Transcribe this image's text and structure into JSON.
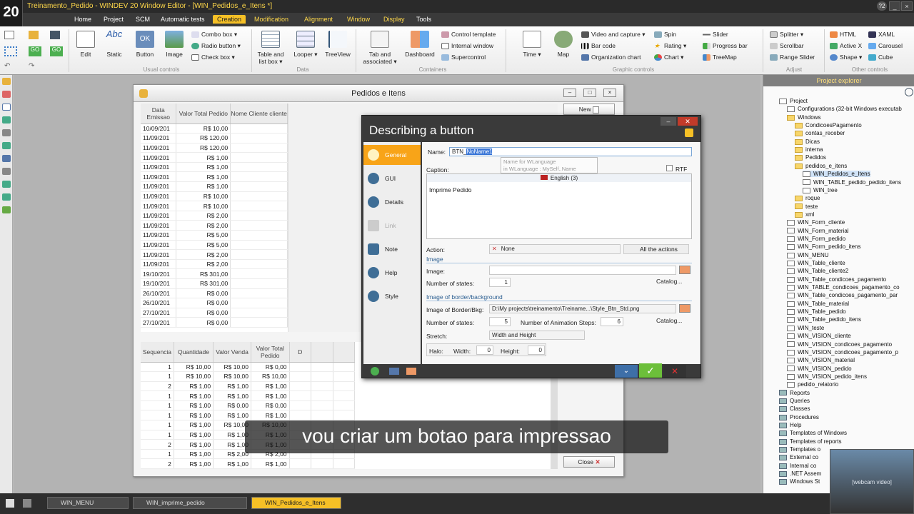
{
  "app": {
    "logo": "20",
    "title": "Treinamento_Pedido - WINDEV 20  Window Editor - [WIN_Pedidos_e_Itens *]",
    "badge": "?2"
  },
  "menu": [
    "Home",
    "Project",
    "SCM",
    "Automatic tests",
    "Creation",
    "Modification",
    "Alignment",
    "Window",
    "Display",
    "Tools"
  ],
  "ribbon": {
    "usual": [
      "Edit",
      "Static",
      "Button",
      "Image"
    ],
    "usual_small": [
      "Combo box",
      "Radio button",
      "Check box"
    ],
    "usual_label": "Usual controls",
    "data": [
      "Table and list box",
      "Looper",
      "TreeView"
    ],
    "data_label": "Data",
    "containers": [
      "Tab and associated",
      "Dashboard"
    ],
    "containers_small": [
      "Control template",
      "Internal window",
      "Supercontrol"
    ],
    "containers_label": "Containers",
    "graphic": [
      "Time",
      "Map"
    ],
    "graphic_small": [
      "Video and capture",
      "Bar code",
      "Organization chart",
      "Spin",
      "Rating",
      "Chart",
      "Slider",
      "Progress bar",
      "TreeMap"
    ],
    "graphic_label": "Graphic controls",
    "adjust_small": [
      "Splitter",
      "Scrollbar",
      "Range Slider"
    ],
    "adjust_label": "Adjust",
    "other_small": [
      "HTML",
      "Active X",
      "Shape",
      "XAML",
      "Carousel",
      "Cube"
    ],
    "other_label": "Other controls"
  },
  "form": {
    "title": "Pedidos e Itens",
    "t1_headers": [
      "Data Emissao",
      "Valor Total Pedido",
      "Nome Cliente cliente"
    ],
    "t1_rows": [
      [
        "10/09/201",
        "R$ 10,00"
      ],
      [
        "11/09/201",
        "R$ 120,00"
      ],
      [
        "11/09/201",
        "R$ 120,00"
      ],
      [
        "11/09/201",
        "R$ 1,00"
      ],
      [
        "11/09/201",
        "R$ 1,00"
      ],
      [
        "11/09/201",
        "R$ 1,00"
      ],
      [
        "11/09/201",
        "R$ 1,00"
      ],
      [
        "11/09/201",
        "R$ 10,00"
      ],
      [
        "11/09/201",
        "R$ 10,00"
      ],
      [
        "11/09/201",
        "R$ 2,00"
      ],
      [
        "11/09/201",
        "R$ 2,00"
      ],
      [
        "11/09/201",
        "R$ 5,00"
      ],
      [
        "11/09/201",
        "R$ 5,00"
      ],
      [
        "11/09/201",
        "R$ 2,00"
      ],
      [
        "11/09/201",
        "R$ 2,00"
      ],
      [
        "19/10/201",
        "R$ 301,00"
      ],
      [
        "19/10/201",
        "R$ 301,00"
      ],
      [
        "26/10/201",
        "R$ 0,00"
      ],
      [
        "26/10/201",
        "R$ 0,00"
      ],
      [
        "27/10/201",
        "R$ 0,00"
      ],
      [
        "27/10/201",
        "R$ 0,00"
      ]
    ],
    "t2_headers": [
      "Sequencia",
      "Quantidade",
      "Valor Venda",
      "Valor Total Pedido",
      "D"
    ],
    "t2_rows": [
      [
        "1",
        "R$ 10,00",
        "R$ 10,00",
        "R$ 0,00"
      ],
      [
        "1",
        "R$ 10,00",
        "R$ 10,00",
        "R$ 10,00"
      ],
      [
        "2",
        "R$ 1,00",
        "R$ 1,00",
        "R$ 1,00"
      ],
      [
        "1",
        "R$ 1,00",
        "R$ 1,00",
        "R$ 1,00"
      ],
      [
        "1",
        "R$ 1,00",
        "R$ 0,00",
        "R$ 0,00"
      ],
      [
        "1",
        "R$ 1,00",
        "R$ 1,00",
        "R$ 1,00"
      ],
      [
        "1",
        "R$ 1,00",
        "R$ 10,00",
        "R$ 10,00"
      ],
      [
        "1",
        "R$ 1,00",
        "R$ 1,00",
        "R$ 1,00"
      ],
      [
        "2",
        "R$ 1,00",
        "R$ 1,00",
        "R$ 1,00"
      ],
      [
        "1",
        "R$ 1,00",
        "R$ 2,00",
        "R$ 2,00"
      ],
      [
        "2",
        "R$ 1,00",
        "R$ 1,00",
        "R$ 1,00"
      ]
    ],
    "new_label": "New",
    "close_label": "Close"
  },
  "dialog": {
    "title": "Describing a button",
    "tabs": [
      "General",
      "GUI",
      "Details",
      "Link",
      "Note",
      "Help",
      "Style"
    ],
    "name_label": "Name:",
    "name_prefix": "BTN_",
    "name_selected": "NoName1",
    "tooltip1": "Name for WLanguage",
    "tooltip2": "in WLanguage : MySelf..Name",
    "caption_label": "Caption:",
    "rtf_label": "RTF",
    "language": "English (3)",
    "caption_value": "Imprime Pedido",
    "action_label": "Action:",
    "action_value": "None",
    "all_actions": "All the actions",
    "image_section": "Image",
    "image_label": "Image:",
    "states_label": "Number of states:",
    "states_value": "1",
    "catalog": "Catalog...",
    "border_section": "Image of border/background",
    "border_label": "Image of Border/Bkg:",
    "border_value": "D:\\My projects\\treinamento\\Treiname...\\Style_Btn_Std.png",
    "border_states_value": "5",
    "anim_label": "Number of Animation Steps:",
    "anim_value": "6",
    "stretch_label": "Stretch:",
    "stretch_value": "Width and Height",
    "halo_label": "Halo:",
    "width_label": "Width:",
    "width_value": "0",
    "height_label": "Height:",
    "height_value": "0"
  },
  "explorer": {
    "title": "Project explorer",
    "items": [
      "Project",
      "Configurations (32-bit Windows executab",
      "Windows",
      "CondicoesPagamento",
      "contas_receber",
      "Dicas",
      "interna",
      "Pedidos",
      "pedidos_e_itens",
      "WIN_Pedidos_e_Itens",
      "WIN_TABLE_pedido_pedido_itens",
      "WIN_tree",
      "roque",
      "teste",
      "xml",
      "WIN_Form_cliente",
      "WIN_Form_material",
      "WIN_Form_pedido",
      "WIN_Form_pedido_itens",
      "WIN_MENU",
      "WIN_Table_cliente",
      "WIN_Table_cliente2",
      "WIN_Table_condicoes_pagamento",
      "WIN_TABLE_condicoes_pagamento_co",
      "WIN_Table_condicoes_pagamento_par",
      "WIN_Table_material",
      "WIN_Table_pedido",
      "WIN_Table_pedido_itens",
      "WIN_teste",
      "WIN_VISION_cliente",
      "WIN_VISION_condicoes_pagamento",
      "WIN_VISION_condicoes_pagamento_p",
      "WIN_VISION_material",
      "WIN_VISION_pedido",
      "WIN_VISION_pedido_itens",
      "pedido_relatorio",
      "Reports",
      "Queries",
      "Classes",
      "Procedures",
      "Help",
      "Templates of Windows",
      "Templates of reports",
      "Templates o",
      "External co",
      "Internal co",
      ".NET Assem",
      "Windows St"
    ]
  },
  "taskbar": [
    "WIN_MENU",
    "WIN_imprime_pedido",
    "WIN_Pedidos_e_Itens"
  ],
  "subtitle": "vou criar um botao para impressao",
  "webcam_note": "[webcam video]"
}
